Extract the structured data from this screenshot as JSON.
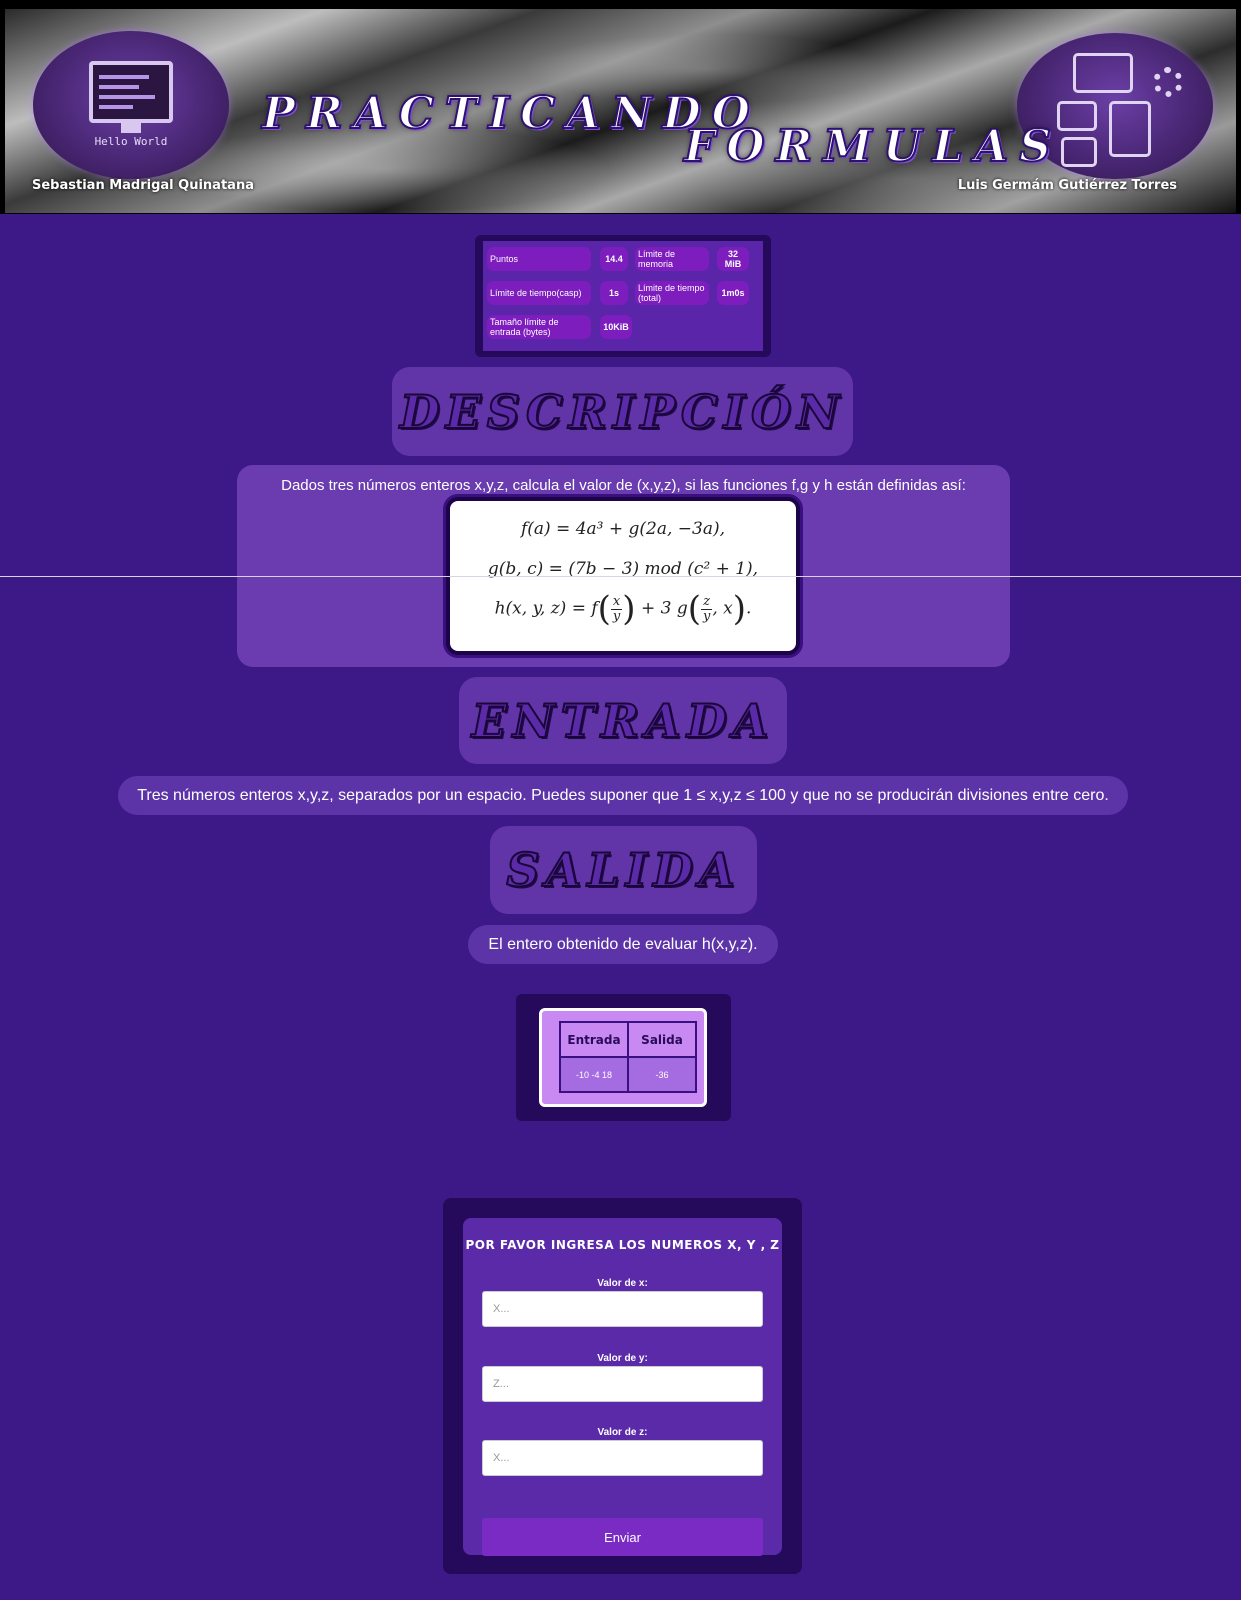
{
  "header": {
    "title_word_1": "PRACTICANDO",
    "title_word_2": "FORMULAS",
    "author_left": "Sebastian Madrigal Quinatana",
    "author_right": "Luis Germám Gutiérrez Torres",
    "logo_left_text": "Hello World"
  },
  "stats": {
    "puntos_label": "Puntos",
    "puntos_value": "14.4",
    "mem_label": "Límite de memoria",
    "mem_value": "32 MiB",
    "time_case_label": "Límite de tiempo(casp)",
    "time_case_value": "1s",
    "time_total_label": "Límite de tiempo (total)",
    "time_total_value": "1m0s",
    "input_size_label": "Tamaño límite de entrada (bytes)",
    "input_size_value": "10KiB"
  },
  "sections": {
    "description_title": "DESCRIPCIÓN",
    "input_title": "ENTRADA",
    "output_title": "SALIDA"
  },
  "description": {
    "text": "Dados tres números enteros x,y,z, calcula el valor de (x,y,z), si las funciones f,g y h están definidas así:",
    "formula_f": "f(a) = 4a³ + g(2a, −3a),",
    "formula_g": "g(b, c) = (7b − 3)   mod  (c² + 1),"
  },
  "input_text": "Tres números enteros x,y,z, separados por un espacio. Puedes suponer que 1 ≤ x,y,z ≤ 100 y que no se producirán divisiones entre cero.",
  "output_text": "El entero obtenido de evaluar h(x,y,z).",
  "example": {
    "col_in": "Entrada",
    "col_out": "Salida",
    "in_value": "-10 -4 18",
    "out_value": "-36"
  },
  "form": {
    "title": "POR FAVOR INGRESA LOS NUMEROS X, Y , Z",
    "label_x": "Valor de x:",
    "placeholder_x": "X...",
    "label_y": "Valor de y:",
    "placeholder_y": "Z...",
    "label_z": "Valor de z:",
    "placeholder_z": "X...",
    "submit": "Enviar"
  },
  "colors": {
    "background": "#3d1887",
    "panel": "#6a3cb0",
    "button": "#7a2bc4"
  }
}
